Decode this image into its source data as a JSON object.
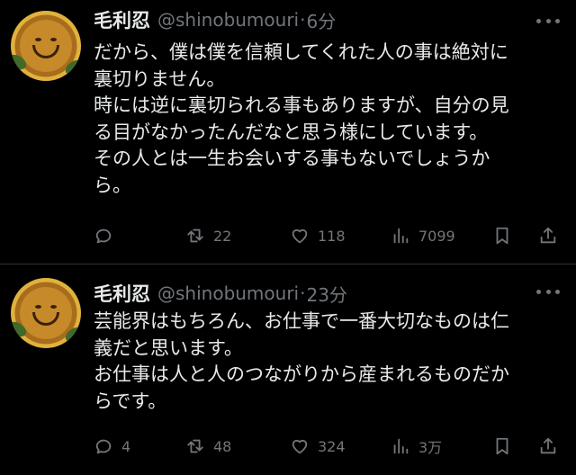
{
  "tweets": [
    {
      "name": "毛利忍",
      "handle": "@shinobumouri",
      "separator": "·",
      "time": "6分",
      "lines": [
        "だから、僕は僕を信頼してくれた人の事は絶対に",
        "裏切りません。",
        "時には逆に裏切られる事もありますが、自分の見",
        "る目がなかったんだなと思う様にしています。",
        "その人とは一生お会いする事もないでしょうか",
        "ら。"
      ],
      "actions": {
        "reply": "",
        "retweet": "22",
        "like": "118",
        "views": "7099"
      }
    },
    {
      "name": "毛利忍",
      "handle": "@shinobumouri",
      "separator": "·",
      "time": "23分",
      "lines": [
        "芸能界はもちろん、お仕事で一番大切なものは仁",
        "義だと思います。",
        "お仕事は人と人のつながりから産まれるものだか",
        "らです。"
      ],
      "actions": {
        "reply": "4",
        "retweet": "48",
        "like": "324",
        "views": "3万"
      }
    }
  ],
  "icons": {
    "reply": "reply-icon",
    "retweet": "retweet-icon",
    "like": "heart-icon",
    "views": "views-icon",
    "bookmark": "bookmark-icon",
    "share": "share-icon",
    "more": "more-icon"
  },
  "colors": {
    "background": "#000000",
    "text": "#e7e9ea",
    "muted": "#71767b",
    "divider": "#2f3336"
  }
}
